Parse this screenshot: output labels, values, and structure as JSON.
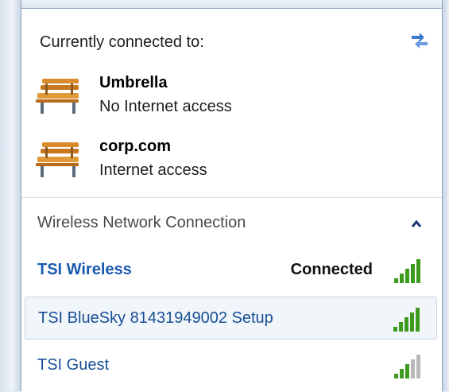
{
  "current": {
    "title": "Currently connected to:",
    "networks": [
      {
        "name": "Umbrella",
        "status": "No Internet access",
        "icon": "bench-icon"
      },
      {
        "name": "corp.com",
        "status": "Internet access",
        "icon": "bench-icon"
      }
    ]
  },
  "wireless": {
    "group_label": "Wireless Network Connection",
    "collapse_icon": "chevron-up-icon",
    "networks": [
      {
        "name": "TSI Wireless",
        "status": "Connected",
        "signal": 5,
        "max_signal": 5
      },
      {
        "name": "TSI BlueSky 81431949002 Setup",
        "status": "",
        "signal": 5,
        "max_signal": 5
      },
      {
        "name": "TSI Guest",
        "status": "",
        "signal": 3,
        "max_signal": 5
      }
    ]
  },
  "colors": {
    "signal_active": "#3c9a1c",
    "signal_inactive": "#b9b9b9",
    "link_blue": "#1a5ab0",
    "selection": "#f1f6fb"
  }
}
